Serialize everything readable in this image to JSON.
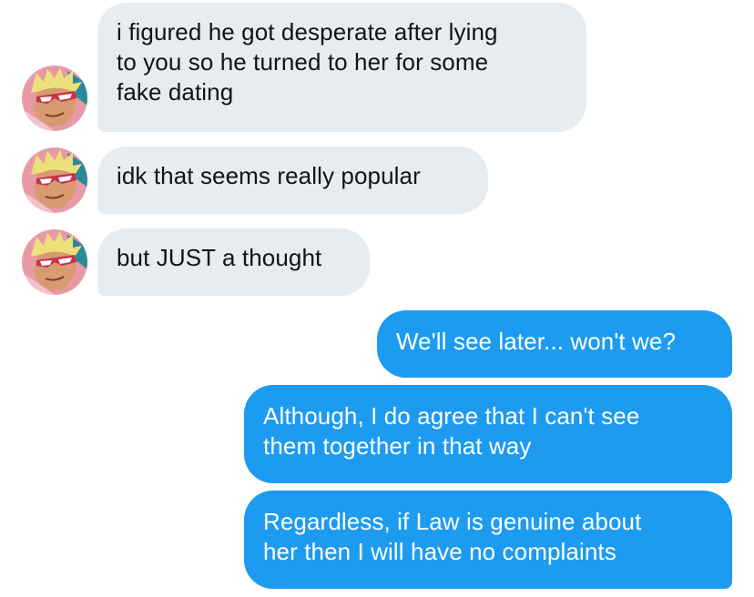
{
  "colors": {
    "incoming_bubble": "#e7ecf0",
    "incoming_text": "#0f1419",
    "outgoing_bubble": "#1d9bf0",
    "outgoing_text": "#ffffff"
  },
  "avatar_icon": "user-avatar-icon",
  "messages": [
    {
      "direction": "incoming",
      "text": "i figured he got desperate after lying\nto you so he turned to her for some\nfake dating"
    },
    {
      "direction": "incoming",
      "text": "idk that seems really popular"
    },
    {
      "direction": "incoming",
      "text": "but JUST a thought"
    },
    {
      "direction": "outgoing",
      "text": "We'll see later... won't we?"
    },
    {
      "direction": "outgoing",
      "text": "Although, I do agree that I can't see\nthem together in that way"
    },
    {
      "direction": "outgoing",
      "text": "Regardless, if Law is genuine about\nher then I will have no complaints"
    }
  ]
}
